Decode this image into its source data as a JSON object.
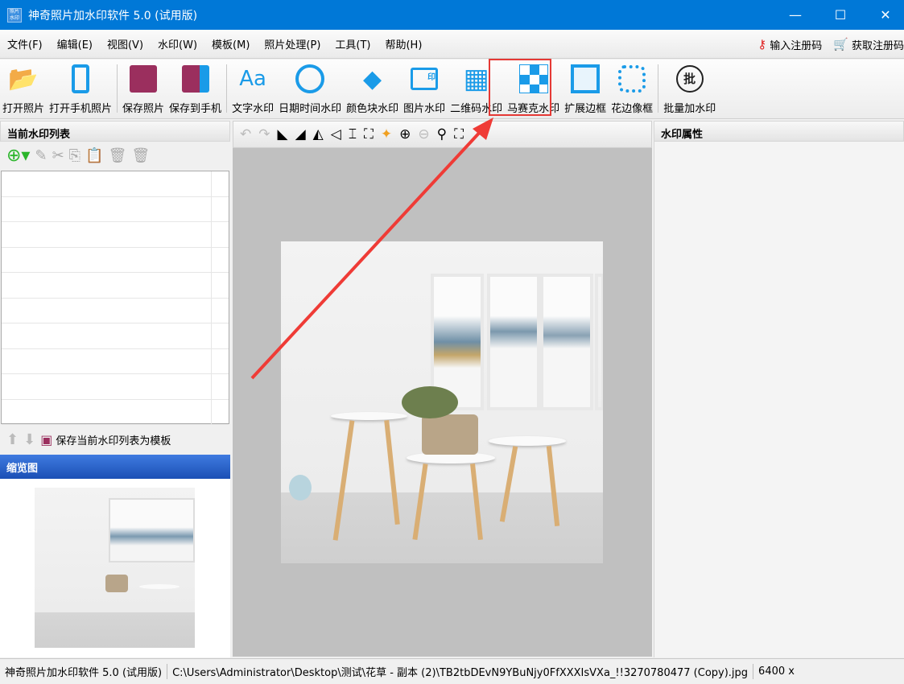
{
  "window": {
    "title": "神奇照片加水印软件 5.0 (试用版)",
    "icon_text": "照片水印"
  },
  "menu": [
    "文件(F)",
    "编辑(E)",
    "视图(V)",
    "水印(W)",
    "模板(M)",
    "照片处理(P)",
    "工具(T)",
    "帮助(H)"
  ],
  "registration": {
    "enter_code": "输入注册码",
    "get_code": "获取注册码"
  },
  "toolbar": [
    {
      "label": "打开照片",
      "icon": "open-folder-icon"
    },
    {
      "label": "打开手机照片",
      "icon": "phone-icon"
    },
    {
      "label": "保存照片",
      "icon": "save-icon"
    },
    {
      "label": "保存到手机",
      "icon": "save-to-phone-icon"
    },
    {
      "label": "文字水印",
      "icon": "text-icon"
    },
    {
      "label": "日期时间水印",
      "icon": "clock-icon"
    },
    {
      "label": "颜色块水印",
      "icon": "paint-bucket-icon"
    },
    {
      "label": "图片水印",
      "icon": "image-watermark-icon"
    },
    {
      "label": "二维码水印",
      "icon": "qrcode-icon"
    },
    {
      "label": "马赛克水印",
      "icon": "mosaic-icon"
    },
    {
      "label": "扩展边框",
      "icon": "border-icon"
    },
    {
      "label": "花边像框",
      "icon": "frame-icon"
    },
    {
      "label": "批量加水印",
      "icon": "batch-icon"
    }
  ],
  "left": {
    "list_title": "当前水印列表",
    "save_template": "保存当前水印列表为模板",
    "thumbnail_title": "缩览图"
  },
  "right": {
    "title": "水印属性"
  },
  "status": {
    "app": "神奇照片加水印软件 5.0 (试用版)",
    "path": "C:\\Users\\Administrator\\Desktop\\测试\\花草 - 副本 (2)\\TB2tbDEvN9YBuNjy0FfXXXIsVXa_!!3270780477 (Copy).jpg",
    "size": "6400 x"
  },
  "colors": {
    "titlebar": "#0078d7",
    "accent": "#1a9be8",
    "highlight": "#e53935"
  }
}
